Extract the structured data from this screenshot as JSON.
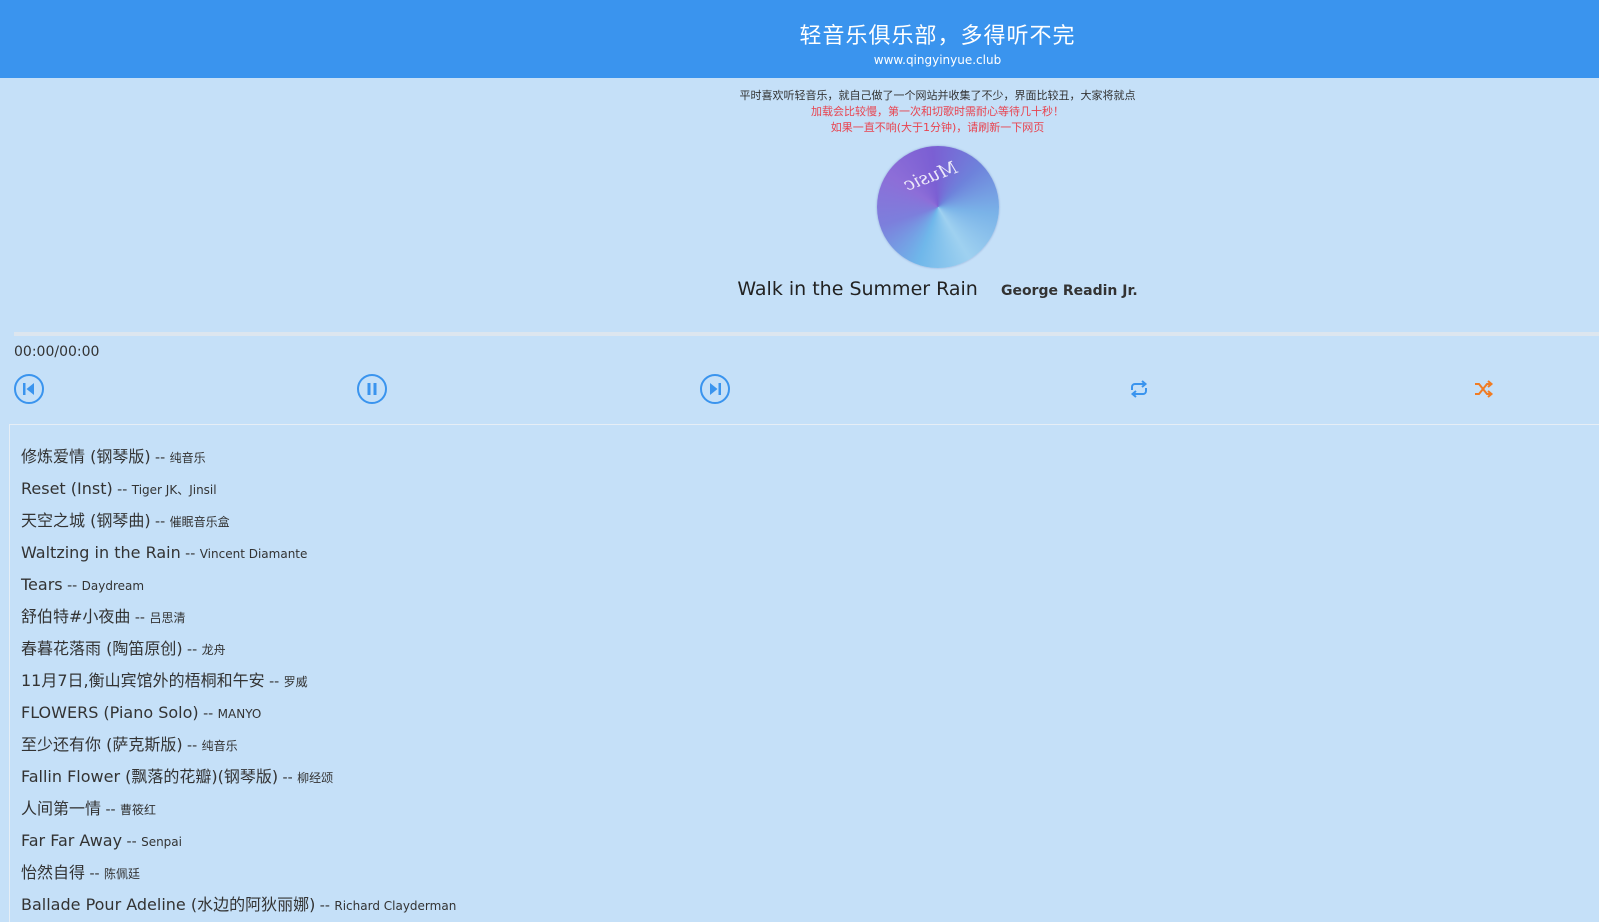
{
  "header": {
    "title": "轻音乐俱乐部，多得听不完",
    "url": "www.qingyinyue.club"
  },
  "notice": {
    "line1": "平时喜欢听轻音乐，就自己做了一个网站并收集了不少，界面比较丑，大家将就点",
    "line2": "加载会比较慢，第一次和切歌时需耐心等待几十秒！",
    "line3": "如果一直不响(大于1分钟)，请刷新一下网页"
  },
  "disc": {
    "logo_text": "Music"
  },
  "player": {
    "song_title": "Walk in the Summer Rain",
    "artist": "George Readin Jr.",
    "time": "00:00/00:00",
    "progress": 0
  },
  "controls": {
    "prev_icon": "skip-previous-icon",
    "pause_icon": "pause-icon",
    "next_icon": "skip-next-icon",
    "repeat_icon": "repeat-icon",
    "shuffle_icon": "shuffle-icon"
  },
  "colors": {
    "accent": "#3a94ee",
    "background": "#c5e0f8",
    "shuffle_active": "#f07c24",
    "warning": "#e8434f"
  },
  "playlist": {
    "separator": " -- ",
    "items": [
      {
        "title": "修炼爱情 (钢琴版)",
        "artist": "纯音乐"
      },
      {
        "title": "Reset (Inst)",
        "artist": "Tiger JK、Jinsil"
      },
      {
        "title": "天空之城 (钢琴曲)",
        "artist": "催眠音乐盒"
      },
      {
        "title": "Waltzing in the Rain",
        "artist": "Vincent Diamante"
      },
      {
        "title": "Tears",
        "artist": "Daydream"
      },
      {
        "title": "舒伯特#小夜曲",
        "artist": "吕思清"
      },
      {
        "title": "春暮花落雨 (陶笛原创)",
        "artist": "龙舟"
      },
      {
        "title": "11月7日,衡山宾馆外的梧桐和午安",
        "artist": "罗威"
      },
      {
        "title": "FLOWERS (Piano Solo)",
        "artist": "MANYO"
      },
      {
        "title": "至少还有你 (萨克斯版)",
        "artist": "纯音乐"
      },
      {
        "title": "Fallin Flower (飘落的花瓣)(钢琴版)",
        "artist": "柳经颂"
      },
      {
        "title": "人间第一情",
        "artist": "曹筱红"
      },
      {
        "title": "Far Far Away",
        "artist": "Senpai"
      },
      {
        "title": "怡然自得",
        "artist": "陈佩廷"
      },
      {
        "title": "Ballade Pour Adeline (水边的阿狄丽娜)",
        "artist": "Richard Clayderman"
      }
    ]
  }
}
